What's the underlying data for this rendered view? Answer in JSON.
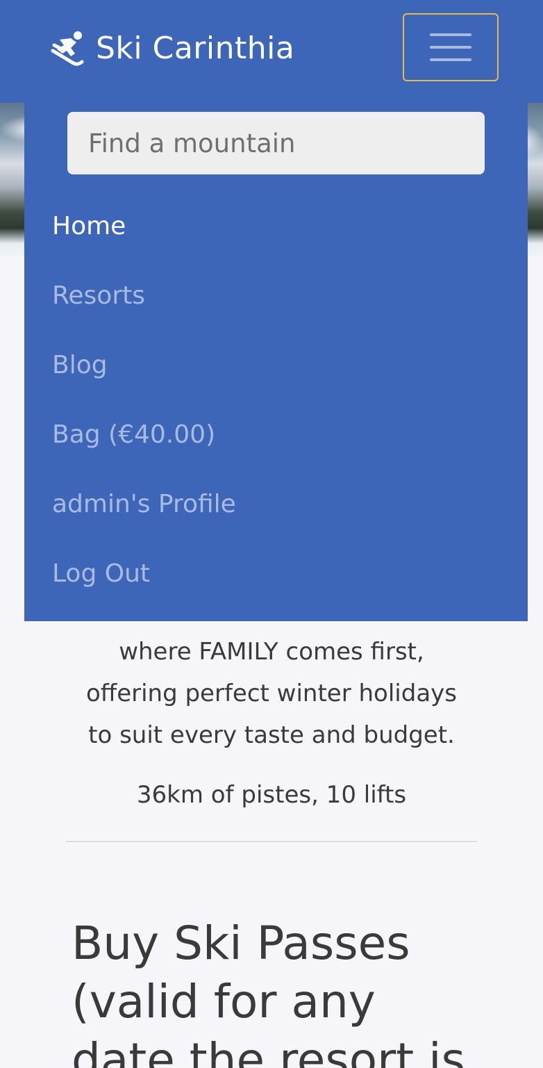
{
  "navbar": {
    "brand": "Ski Carinthia",
    "brand_icon": "skier-icon",
    "toggle_icon": "hamburger-menu-icon",
    "toggle_border_color": "#e6b94d",
    "background": "#3e66b8"
  },
  "search": {
    "placeholder": "Find a mountain",
    "value": ""
  },
  "menu": {
    "items": [
      {
        "label": "Home",
        "active": true
      },
      {
        "label": "Resorts",
        "active": false
      },
      {
        "label": "Blog",
        "active": false
      },
      {
        "label": "Bag (€40.00)",
        "active": false
      },
      {
        "label": "admin's Profile",
        "active": false
      },
      {
        "label": "Log Out",
        "active": false
      }
    ]
  },
  "content": {
    "description_lines": [
      "where FAMILY comes first,",
      "offering perfect winter holidays",
      "to suit every taste and budget."
    ],
    "stats": "36km of pistes, 10 lifts",
    "passes_title": "Buy Ski Passes (valid for any date the resort is"
  }
}
